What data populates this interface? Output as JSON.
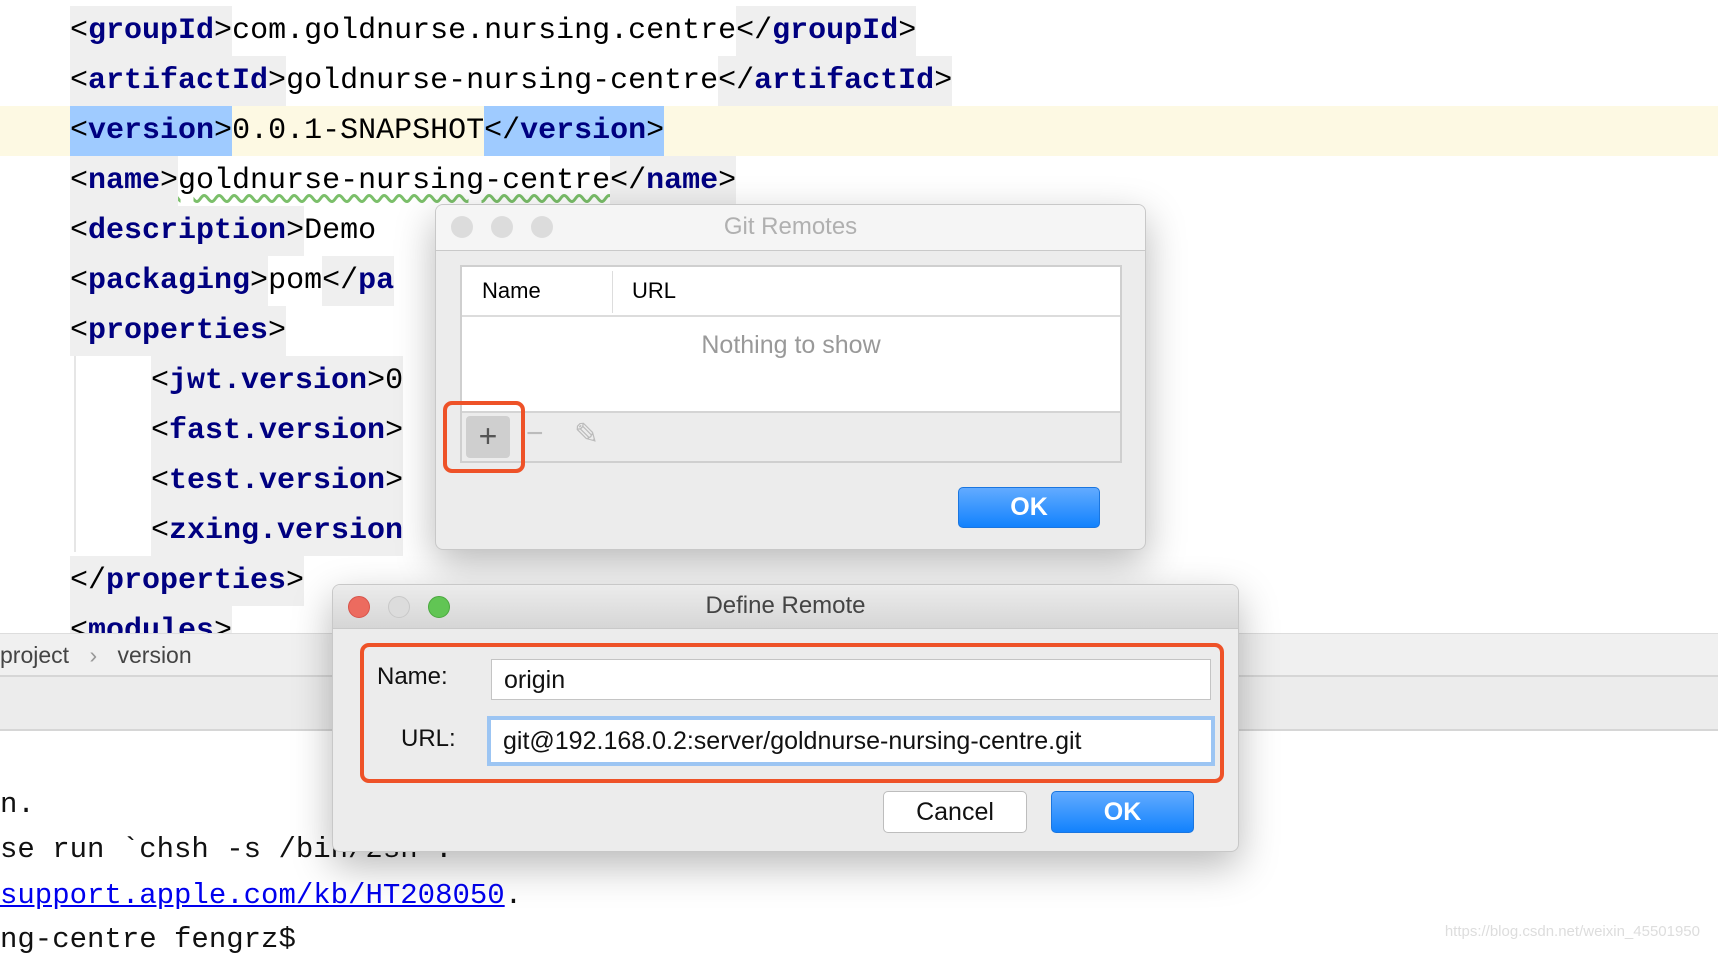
{
  "editor": {
    "lines": [
      {
        "open": "groupId",
        "value": "com.goldnurse.nursing.centre",
        "close": "groupId"
      },
      {
        "open": "artifactId",
        "value": "goldnurse-nursing-centre",
        "close": "artifactId"
      },
      {
        "open": "version",
        "value": "0.0.1-SNAPSHOT",
        "close": "version"
      },
      {
        "open": "name",
        "value": "goldnurse-nursing-centre",
        "close": "name"
      },
      {
        "open": "description",
        "value": "Demo ",
        "close": ""
      },
      {
        "open": "packaging",
        "value": "pom",
        "close": "pa"
      },
      {
        "open": "properties"
      },
      {
        "open": "jwt.version",
        "value": "0"
      },
      {
        "open": "fast.version"
      },
      {
        "open": "test.version"
      },
      {
        "open": "zxing.version"
      },
      {
        "close": "properties"
      },
      {
        "open": "modules"
      }
    ],
    "lt": "<",
    "gt": ">",
    "lts": "</"
  },
  "breadcrumb": {
    "items": [
      "project",
      "version"
    ],
    "separator": "›"
  },
  "terminal": {
    "lines": [
      "n.",
      "se run `chsh -s /bin/zsh`."
    ],
    "link": "support.apple.com/kb/HT208050",
    "link_suffix": ".",
    "prompt": "ng-centre fengrz$"
  },
  "git_remotes": {
    "title": "Git Remotes",
    "columns": [
      "Name",
      "URL"
    ],
    "empty_text": "Nothing to show",
    "add_icon": "+",
    "remove_icon": "−",
    "edit_icon": "✎",
    "ok_label": "OK"
  },
  "define_remote": {
    "title": "Define Remote",
    "name_label": "Name:",
    "name_value": "origin",
    "url_label": "URL:",
    "url_value": "git@192.168.0.2:server/goldnurse-nursing-centre.git",
    "cancel_label": "Cancel",
    "ok_label": "OK"
  },
  "watermark": "https://blog.csdn.net/weixin_45501950",
  "colors": {
    "highlight_box": "#ee5228",
    "primary_button": "#1282fd",
    "tag_name": "#000080"
  }
}
